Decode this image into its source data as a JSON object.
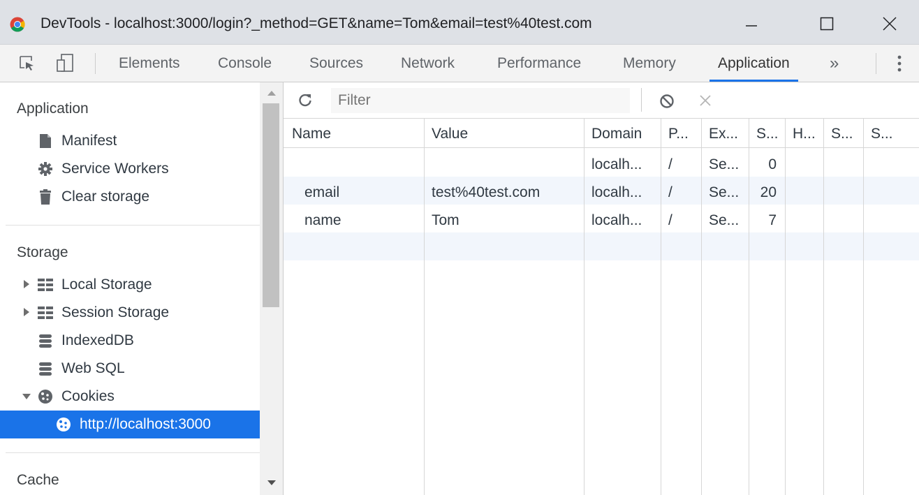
{
  "window": {
    "title": "DevTools - localhost:3000/login?_method=GET&name=Tom&email=test%40test.com",
    "minimize_icon": "minimize-icon",
    "maximize_icon": "maximize-icon",
    "close_icon": "close-icon"
  },
  "tabs": {
    "items": [
      "Elements",
      "Console",
      "Sources",
      "Network",
      "Performance",
      "Memory",
      "Application"
    ],
    "active": "Application",
    "overflow": "»",
    "accent": "#1a73e8"
  },
  "sidebar": {
    "application_header": "Application",
    "application_items": [
      {
        "label": "Manifest",
        "icon": "document-icon"
      },
      {
        "label": "Service Workers",
        "icon": "gear-icon"
      },
      {
        "label": "Clear storage",
        "icon": "trash-icon"
      }
    ],
    "storage_header": "Storage",
    "storage_items": [
      {
        "label": "Local Storage",
        "icon": "grid-icon"
      },
      {
        "label": "Session Storage",
        "icon": "grid-icon"
      },
      {
        "label": "IndexedDB",
        "icon": "database-icon"
      },
      {
        "label": "Web SQL",
        "icon": "database-icon"
      },
      {
        "label": "Cookies",
        "icon": "cookie-icon"
      },
      {
        "label": "http://localhost:3000",
        "icon": "cookie-icon"
      }
    ],
    "cache_header": "Cache",
    "selected_color": "#1a73e8"
  },
  "toolbar": {
    "filter_placeholder": "Filter",
    "refresh_icon": "refresh-icon",
    "clear_icon": "block-icon",
    "delete_icon": "close-icon"
  },
  "table": {
    "columns": [
      "Name",
      "Value",
      "Domain",
      "P...",
      "Ex...",
      "S...",
      "H...",
      "S...",
      "S..."
    ],
    "rows": [
      [
        "",
        "",
        "localh...",
        "/",
        "Se...",
        "0",
        "",
        "",
        ""
      ],
      [
        "email",
        "test%40test.com",
        "localh...",
        "/",
        "Se...",
        "20",
        "",
        "",
        ""
      ],
      [
        "name",
        "Tom",
        "localh...",
        "/",
        "Se...",
        "7",
        "",
        "",
        ""
      ]
    ]
  }
}
